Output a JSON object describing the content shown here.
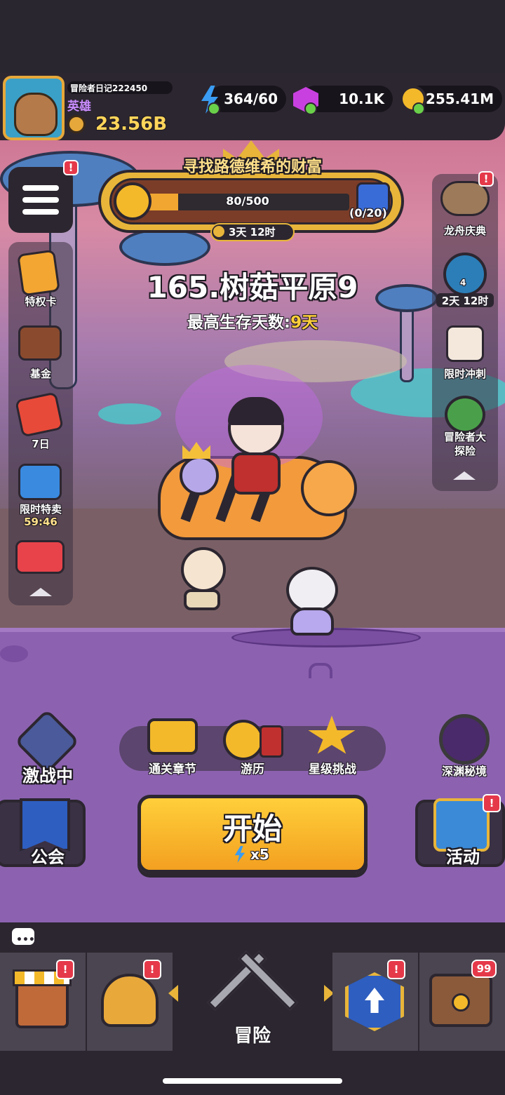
{
  "player": {
    "name": "冒险者日记222450",
    "rank": "英雄",
    "power": "23.56B"
  },
  "resources": {
    "energy": "364/60",
    "gems": "10.1K",
    "gold": "255.41M"
  },
  "event": {
    "title": "寻找路德维希的财富",
    "progress_text": "80/500",
    "progress": 0.16,
    "chest_count": "(0/20)",
    "timer": "3天 12时"
  },
  "stage": {
    "name": "165.树菇平原9",
    "survival_label": "最高生存天数:",
    "survival_value": "9天"
  },
  "left_menu": [
    {
      "label": "特权卡",
      "icon": "privilege-card-icon"
    },
    {
      "label": "基金",
      "icon": "fund-icon"
    },
    {
      "label": "7日",
      "icon": "seven-day-icon"
    },
    {
      "label": "限时特卖",
      "sub": "59:46",
      "icon": "sale-icon"
    },
    {
      "label": "",
      "icon": "gift-box-icon"
    }
  ],
  "right_menu": [
    {
      "label": "龙舟庆典",
      "icon": "dragon-boat-icon"
    },
    {
      "label": "2天 12时",
      "badge_num": "4",
      "icon": "mountain-icon"
    },
    {
      "label": "限时冲刺",
      "icon": "calendar-icon"
    },
    {
      "label": "冒险者大探险",
      "label_line1": "冒险者大",
      "label_line2": "探险",
      "icon": "compass-icon"
    }
  ],
  "battle_mode": "激战中",
  "mid_buttons": [
    {
      "label": "通关章节",
      "icon": "chapter-gate-icon"
    },
    {
      "label": "游历",
      "icon": "travel-compass-icon"
    },
    {
      "label": "星级挑战",
      "icon": "star-challenge-icon"
    }
  ],
  "abyss": "深渊秘境",
  "start": {
    "label": "开始",
    "cost": "x5"
  },
  "guild": "公会",
  "activity": "活动",
  "badges": {
    "alert": "!",
    "chest_count": "99"
  },
  "bottom_nav": [
    {
      "label": "",
      "icon": "shop-icon"
    },
    {
      "label": "",
      "icon": "helmet-icon"
    },
    {
      "label": "冒险",
      "icon": "crossed-swords-icon"
    },
    {
      "label": "",
      "icon": "upgrade-icon"
    },
    {
      "label": "",
      "icon": "treasure-chest-icon"
    }
  ],
  "colors": {
    "accent_gold": "#f3a020",
    "alert_red": "#e5394a",
    "bar_dark": "#2c2630",
    "energy_blue": "#3a9cf2",
    "gem_purple": "#c940e0"
  }
}
